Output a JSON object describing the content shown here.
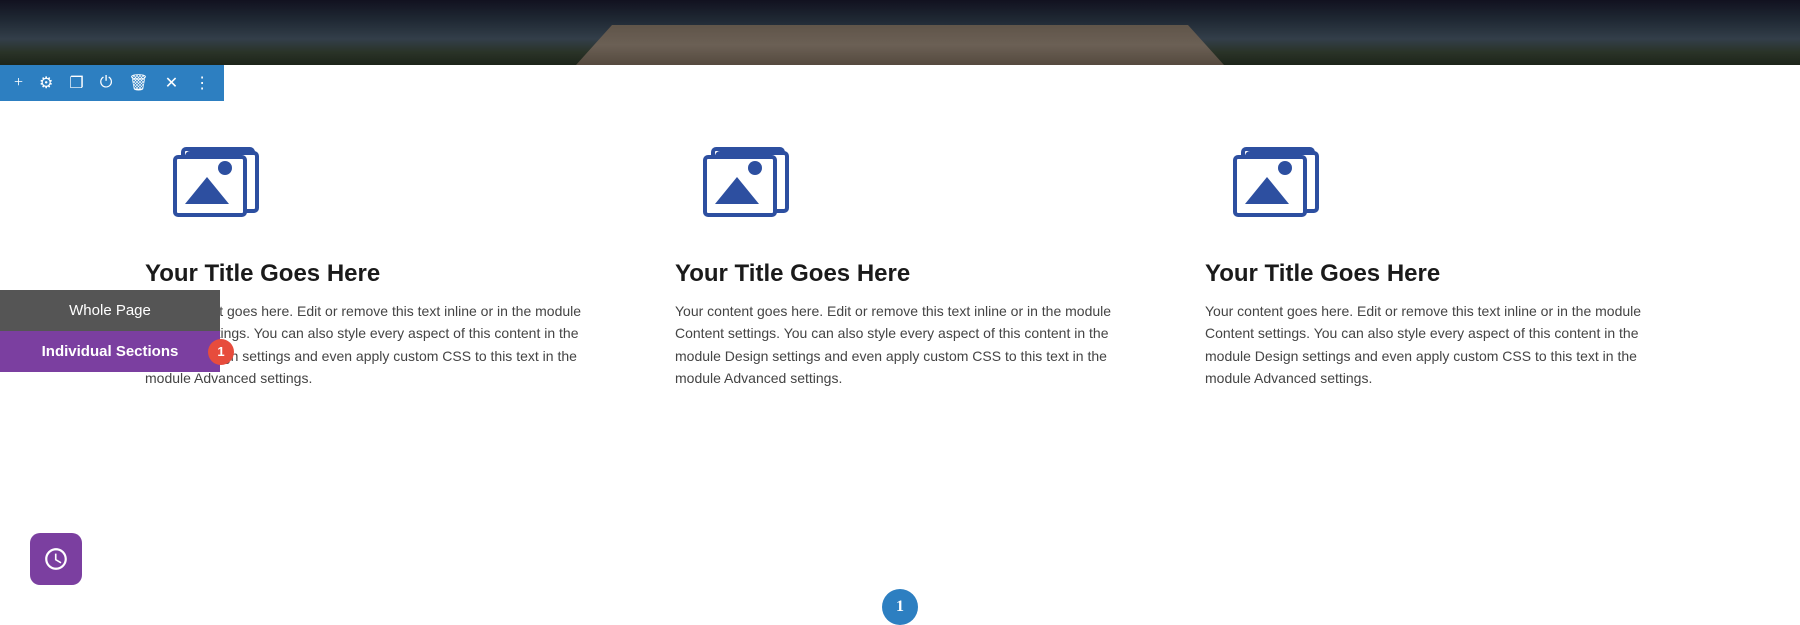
{
  "header": {
    "alt": "Nature bridge landscape"
  },
  "toolbar": {
    "icons": [
      {
        "name": "plus",
        "symbol": "+"
      },
      {
        "name": "gear",
        "symbol": "⚙"
      },
      {
        "name": "crop",
        "symbol": "⬜"
      },
      {
        "name": "power",
        "symbol": "⏻"
      },
      {
        "name": "trash",
        "symbol": "🗑"
      },
      {
        "name": "close",
        "symbol": "✕"
      },
      {
        "name": "more",
        "symbol": "⋮"
      }
    ]
  },
  "columns": [
    {
      "title": "Your Title Goes Here",
      "body": "Your content goes here. Edit or remove this text inline or in the module Content settings. You can also style every aspect of this content in the module Design settings and even apply custom CSS to this text in the module Advanced settings."
    },
    {
      "title": "Your Title Goes Here",
      "body": "Your content goes here. Edit or remove this text inline or in the module Content settings. You can also style every aspect of this content in the module Design settings and even apply custom CSS to this text in the module Advanced settings."
    },
    {
      "title": "Your Title Goes Here",
      "body": "Your content goes here. Edit or remove this text inline or in the module Content settings. You can also style every aspect of this content in the module Design settings and even apply custom CSS to this text in the module Advanced settings."
    }
  ],
  "side_panel": {
    "whole_page_label": "Whole Page",
    "individual_sections_label": "Individual Sections",
    "badge_count": "1"
  },
  "pagination": {
    "current": "1"
  },
  "colors": {
    "toolbar_bg": "#2d7fc1",
    "whole_page_btn": "#555555",
    "individual_btn": "#7b3fa0",
    "badge": "#e74c3c",
    "icon_blue": "#2d4fa0",
    "pagination_blue": "#2d7fc1"
  }
}
